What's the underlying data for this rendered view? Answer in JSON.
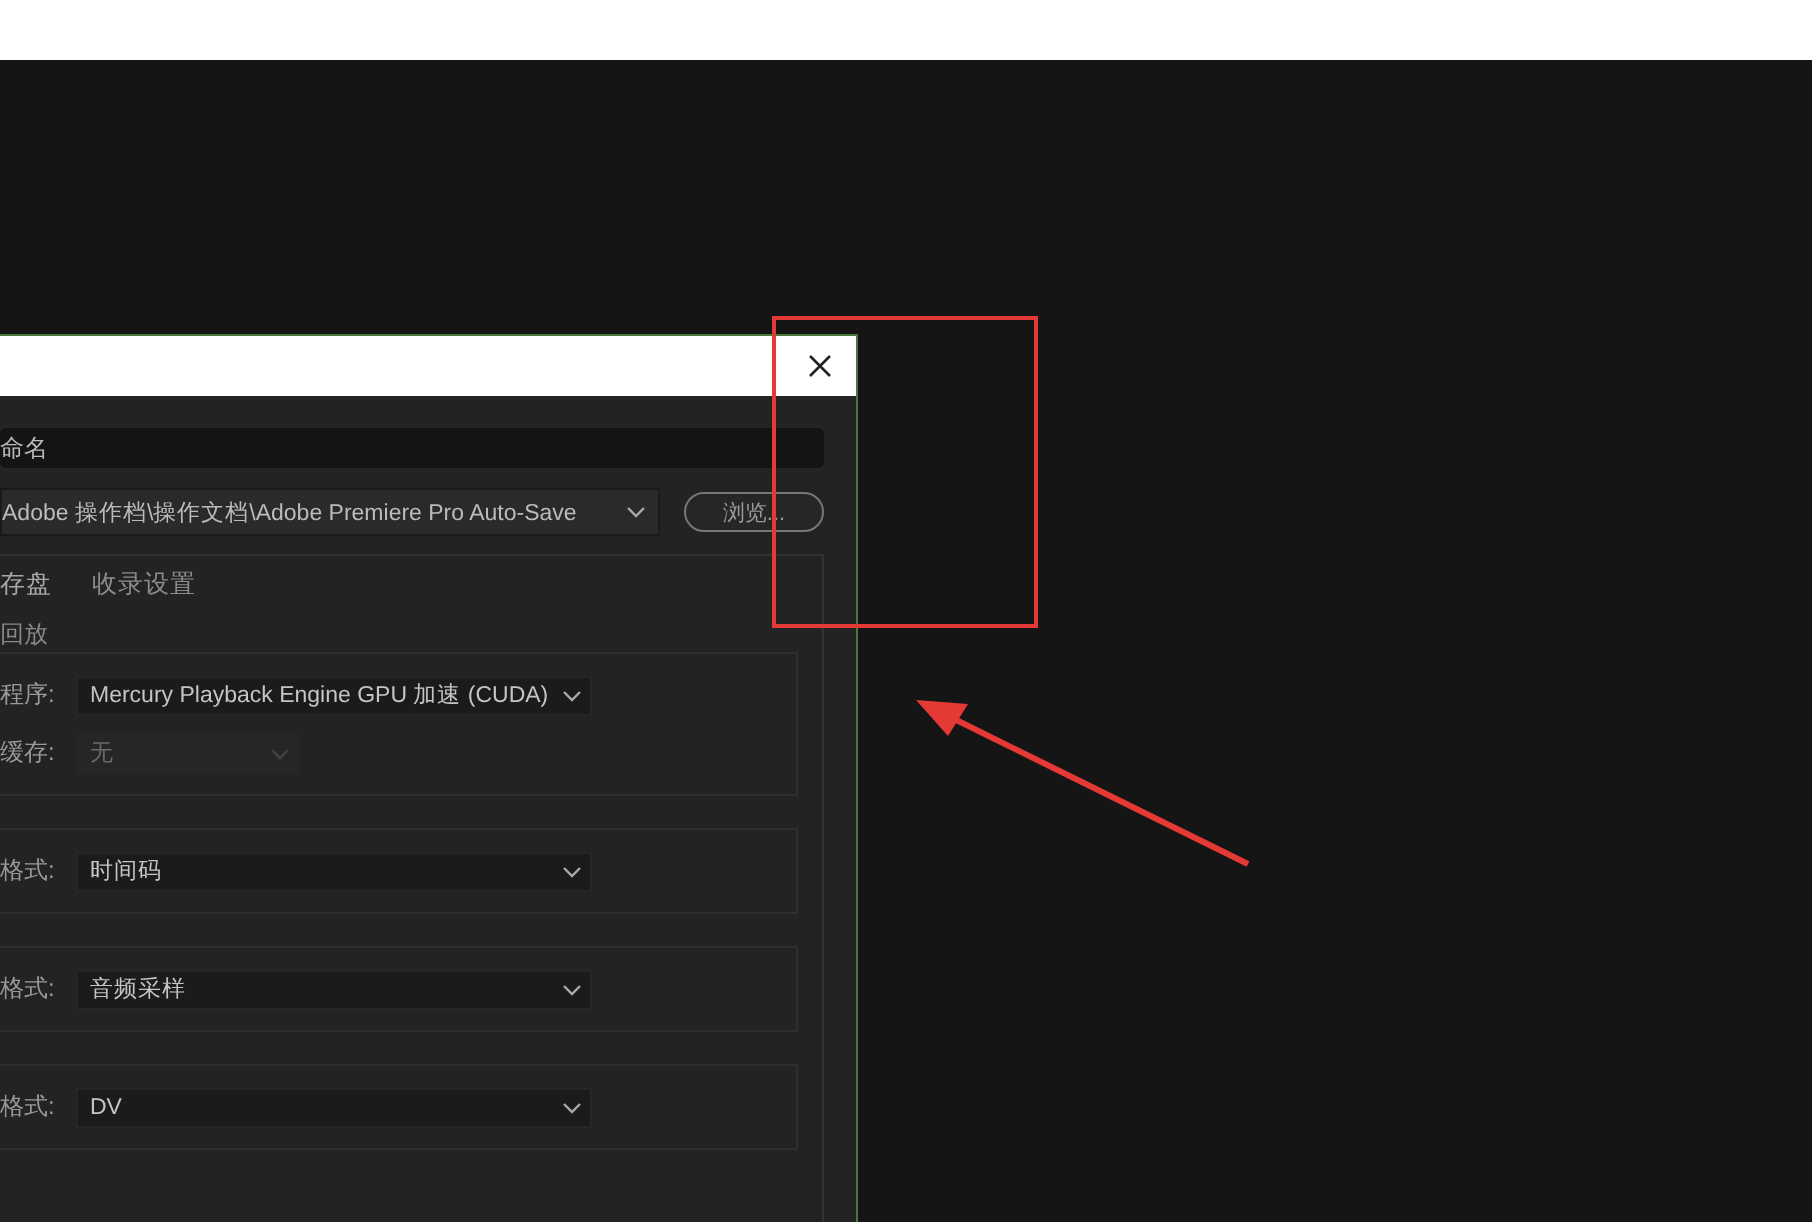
{
  "dialog": {
    "name_field": {
      "value": "命名"
    },
    "location": {
      "value": "Adobe 操作档\\操作文档\\Adobe Premiere Pro Auto-Save",
      "browse_button": "浏览..."
    },
    "tabs": [
      {
        "label": "存盘",
        "selected": true
      },
      {
        "label": "收录设置",
        "selected": false
      }
    ],
    "groups": [
      {
        "title": "回放",
        "rows": [
          {
            "label": "程序:",
            "value": "Mercury Playback Engine GPU 加速 (CUDA)",
            "disabled": false
          },
          {
            "label": "缓存:",
            "value": "无",
            "disabled": true
          }
        ]
      },
      {
        "rows": [
          {
            "label": "格式:",
            "value": "时间码",
            "disabled": false
          }
        ]
      },
      {
        "rows": [
          {
            "label": "格式:",
            "value": "音频采样",
            "disabled": false
          }
        ]
      },
      {
        "rows": [
          {
            "label": "格式:",
            "value": "DV",
            "disabled": false
          }
        ]
      }
    ]
  }
}
